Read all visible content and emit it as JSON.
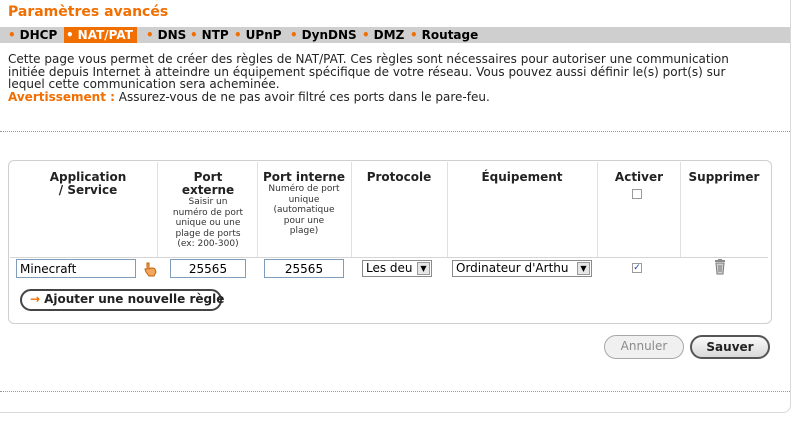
{
  "page": {
    "title": "Paramètres avancés"
  },
  "nav": {
    "bullet": "•",
    "items": [
      {
        "label": "DHCP",
        "active": false
      },
      {
        "label": "NAT/PAT",
        "active": true
      },
      {
        "label": "DNS",
        "active": false
      },
      {
        "label": "NTP",
        "active": false
      },
      {
        "label": "UPnP",
        "active": false
      },
      {
        "label": "DynDNS",
        "active": false
      },
      {
        "label": "DMZ",
        "active": false
      },
      {
        "label": "Routage",
        "active": false
      }
    ]
  },
  "description": {
    "line1": "Cette page vous permet de créer des règles de NAT/PAT. Ces règles sont nécessaires pour autoriser une communication",
    "line2": "initiée depuis Internet à atteindre un équipement spécifique de votre réseau. Vous pouvez aussi définir le(s) port(s) sur",
    "line3": "lequel cette communication sera acheminée.",
    "warning_label": "Avertissement :",
    "warning_text": " Assurez-vous de ne pas avoir filtré ces ports dans le pare-feu."
  },
  "table": {
    "headers": {
      "application_1": "Application",
      "application_2": "/ Service",
      "port_ext_1": "Port",
      "port_ext_2": "externe",
      "port_ext_hint_1": "Saisir un",
      "port_ext_hint_2": "numéro de port",
      "port_ext_hint_3": "unique ou une",
      "port_ext_hint_4": "plage de ports",
      "port_ext_hint_5": "(ex: 200-300)",
      "port_int": "Port interne",
      "port_int_hint_1": "Numéro de port",
      "port_int_hint_2": "unique",
      "port_int_hint_3": "(automatique",
      "port_int_hint_4": "pour une",
      "port_int_hint_5": "plage)",
      "protocol": "Protocole",
      "device": "Équipement",
      "activate": "Activer",
      "delete": "Supprimer"
    },
    "header_activate_all_checked": false,
    "rows": [
      {
        "application": "Minecraft",
        "port_external": "25565",
        "port_internal": "25565",
        "protocol": "Les deu",
        "device": "Ordinateur d'Arthu",
        "enabled": true
      }
    ],
    "add_rule_label": "Ajouter une nouvelle règle",
    "add_rule_arrow": "→"
  },
  "actions": {
    "cancel_label": "Annuler",
    "save_label": "Sauver"
  },
  "colors": {
    "accent": "#f16e00",
    "nav_bg": "#cfcfcf"
  }
}
